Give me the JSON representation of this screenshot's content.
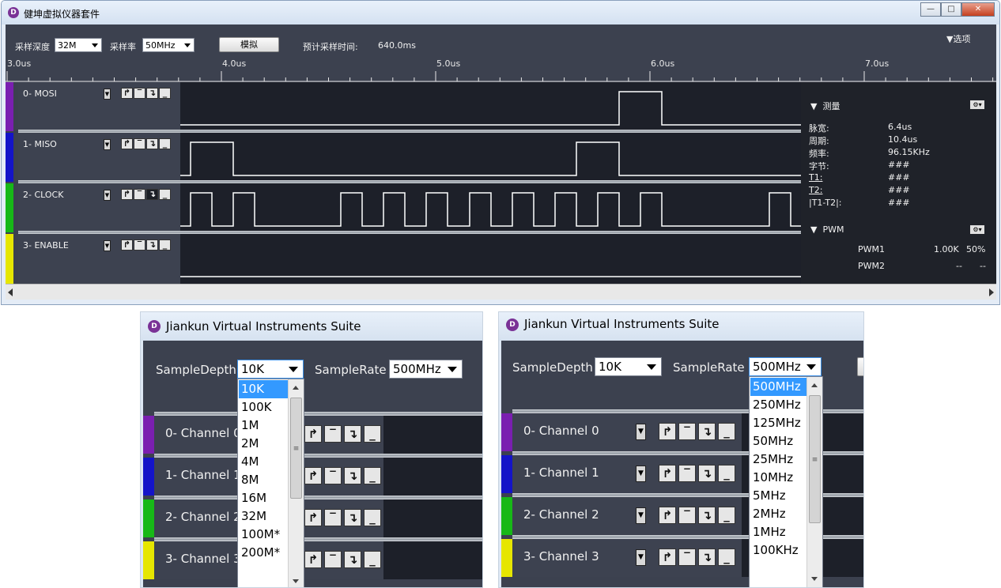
{
  "app": {
    "title": "健坤虚拟仪器套件",
    "logo": "D",
    "toolbar": {
      "depth_label": "采样深度",
      "depth_value": "32M",
      "rate_label": "采样率",
      "rate_value": "50MHz",
      "simulate_button": "模拟",
      "est_label": "预计采样时间:",
      "est_value": "640.0ms",
      "options": "选项"
    },
    "ruler": {
      "ticks": [
        "3.0us",
        "4.0us",
        "5.0us",
        "6.0us",
        "7.0us"
      ]
    },
    "channels": [
      {
        "name": "0- MOSI",
        "color": "#7a1fb0"
      },
      {
        "name": "1- MISO",
        "color": "#1414c8"
      },
      {
        "name": "2- CLOCK",
        "color": "#17b817"
      },
      {
        "name": "3- ENABLE",
        "color": "#e6e600"
      }
    ],
    "measure": {
      "title": "测量",
      "rows": [
        {
          "k": "脉宽:",
          "v": "6.4us"
        },
        {
          "k": "周期:",
          "v": "10.4us"
        },
        {
          "k": "频率:",
          "v": "96.15KHz"
        },
        {
          "k": "字节:",
          "v": "###"
        },
        {
          "k": "T1:",
          "v": "###"
        },
        {
          "k": "T2:",
          "v": "###"
        },
        {
          "k": "|T1-T2|:",
          "v": "###"
        }
      ]
    },
    "pwm": {
      "title": "PWM",
      "rows": [
        {
          "name": "PWM1",
          "freq": "1.00K",
          "duty": "50%"
        },
        {
          "name": "PWM2",
          "freq": "--",
          "duty": "--"
        }
      ]
    }
  },
  "dialogs": [
    {
      "title": "Jiankun Virtual Instruments Suite",
      "depth_label": "SampleDepth",
      "depth_value": "10K",
      "rate_label": "SampleRate",
      "rate_value": "500MHz",
      "channels": [
        "0- Channel 0",
        "1- Channel 1",
        "2- Channel 2",
        "3- Channel 3"
      ],
      "list": [
        "10K",
        "100K",
        "1M",
        "2M",
        "4M",
        "8M",
        "16M",
        "32M",
        "100M*",
        "200M*"
      ],
      "selected": "10K"
    },
    {
      "title": "Jiankun Virtual Instruments Suite",
      "depth_label": "SampleDepth",
      "depth_value": "10K",
      "rate_label": "SampleRate",
      "rate_value": "500MHz",
      "channels": [
        "0- Channel 0",
        "1- Channel 1",
        "2- Channel 2",
        "3- Channel 3"
      ],
      "list": [
        "500MHz",
        "250MHz",
        "125MHz",
        "50MHz",
        "25MHz",
        "10MHz",
        "5MHz",
        "2MHz",
        "1MHz",
        "100KHz"
      ],
      "selected": "500MHz"
    }
  ],
  "colors": {
    "accent": "#3399ff",
    "wave": "#ffffff",
    "panel": "#1f2229"
  }
}
